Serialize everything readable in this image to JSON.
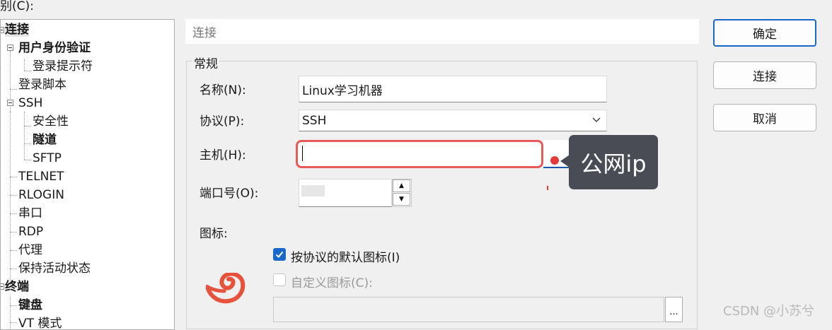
{
  "dialog": {
    "category_label": "别(C):",
    "header_title": "连接",
    "group_title": "常规"
  },
  "tree": {
    "items": [
      {
        "label": "连接",
        "bold": true,
        "selected": true
      },
      {
        "label": "用户身份验证",
        "bold": true
      },
      {
        "label": "登录提示符"
      },
      {
        "label": "登录脚本"
      },
      {
        "label": "SSH"
      },
      {
        "label": "安全性"
      },
      {
        "label": "隧道",
        "bold": true
      },
      {
        "label": "SFTP"
      },
      {
        "label": "TELNET"
      },
      {
        "label": "RLOGIN"
      },
      {
        "label": "串口"
      },
      {
        "label": "RDP"
      },
      {
        "label": "代理"
      },
      {
        "label": "保持活动状态"
      },
      {
        "label": "终端",
        "bold": true
      },
      {
        "label": "键盘",
        "bold": true
      },
      {
        "label": "VT 模式"
      }
    ]
  },
  "form": {
    "name_label": "名称(N):",
    "name_value": "Linux学习机器",
    "protocol_label": "协议(P):",
    "protocol_value": "SSH",
    "host_label": "主机(H):",
    "host_value": "",
    "port_label": "端口号(O):",
    "port_value": "",
    "icon_label": "图标:",
    "default_icon_label": "按协议的默认图标(I)",
    "default_icon_checked": true,
    "custom_icon_label": "自定义图标(C):",
    "custom_icon_checked": false,
    "custom_icon_path": "",
    "browse_label": "..."
  },
  "buttons": {
    "ok": "确定",
    "connect": "连接",
    "cancel": "取消"
  },
  "annotation": {
    "text": "公网ip"
  },
  "watermark": "CSDN @小苏兮",
  "colors": {
    "accent": "#1967c8",
    "highlight_border": "#e85a5a",
    "annotation_bg": "#4a4c55",
    "logo": "#e5533d"
  }
}
